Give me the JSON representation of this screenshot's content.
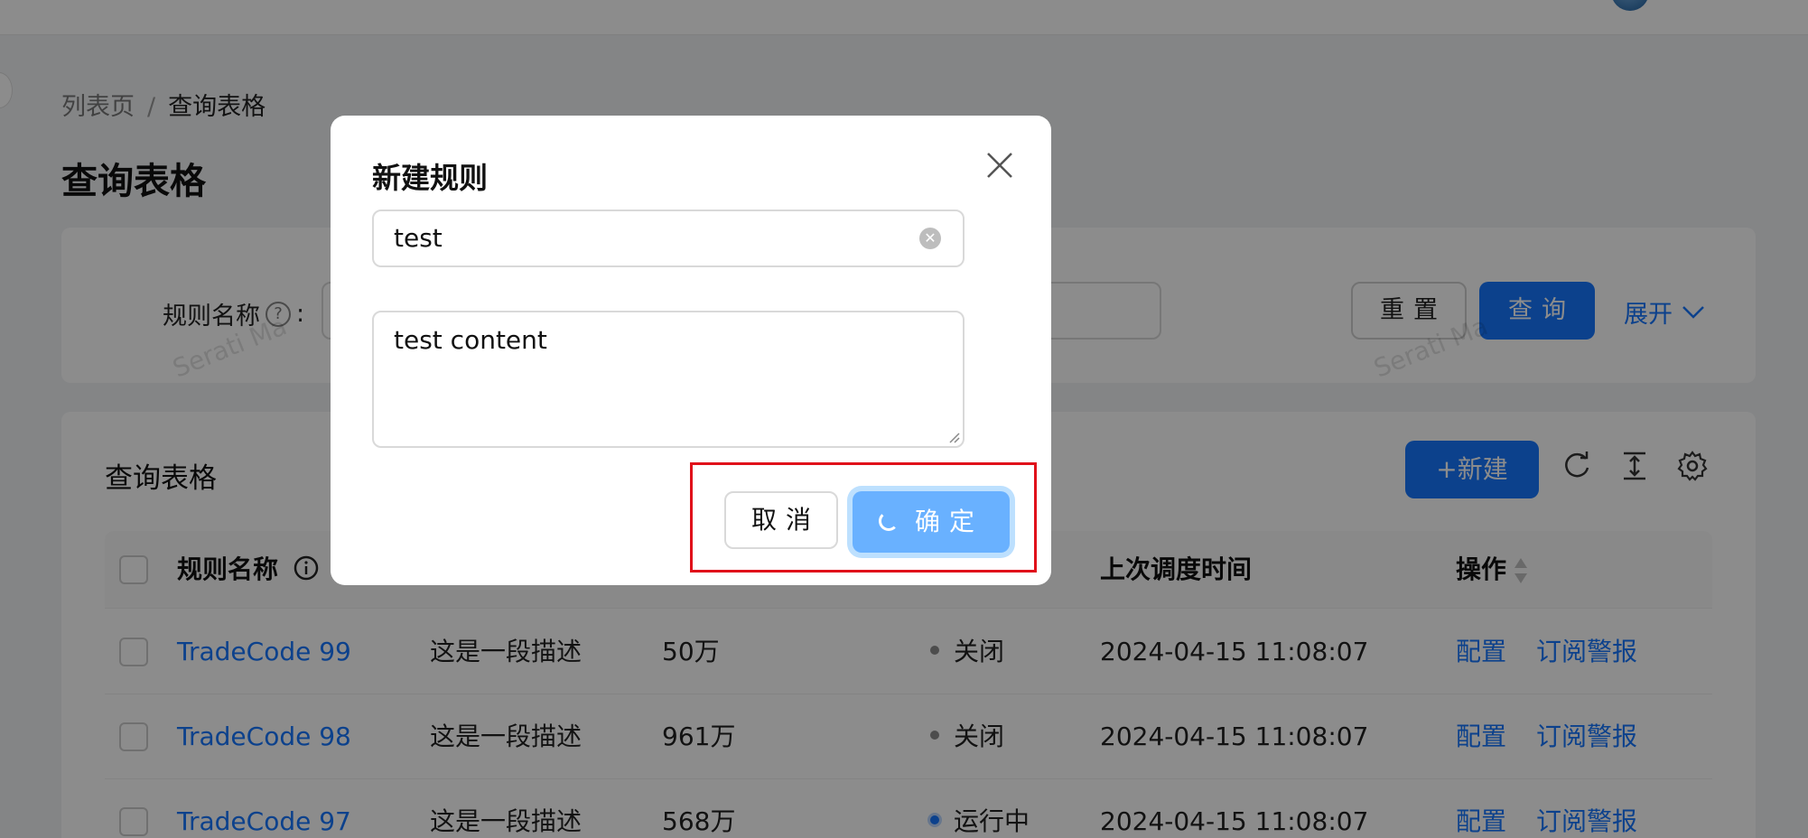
{
  "breadcrumb": {
    "parent": "列表页",
    "separator": "/",
    "current": "查询表格"
  },
  "page_title": "查询表格",
  "search_form": {
    "field_label": "规则名称",
    "help_icon": "question-circle-icon",
    "colon": ":",
    "reset_label": "重置",
    "query_label": "查询",
    "expand_label": "展开"
  },
  "table": {
    "title": "查询表格",
    "new_label": "+新建",
    "columns": [
      "规则名称",
      "上次调度时间",
      "操作"
    ],
    "rows": [
      {
        "name": "TradeCode 99",
        "desc": "这是一段描述",
        "calls": "50万",
        "status": "关闭",
        "status_color": "#8c8c8c",
        "time": "2024-04-15 11:08:07",
        "action1": "配置",
        "action2": "订阅警报"
      },
      {
        "name": "TradeCode 98",
        "desc": "这是一段描述",
        "calls": "961万",
        "status": "关闭",
        "status_color": "#8c8c8c",
        "time": "2024-04-15 11:08:07",
        "action1": "配置",
        "action2": "订阅警报"
      },
      {
        "name": "TradeCode 97",
        "desc": "这是一段描述",
        "calls": "568万",
        "status": "运行中",
        "status_color": "#1677ff",
        "time": "2024-04-15 11:08:07",
        "action1": "配置",
        "action2": "订阅警报"
      }
    ]
  },
  "watermark": "Serati Ma",
  "modal": {
    "title": "新建规则",
    "name_value": "test",
    "content_value": "test content",
    "cancel_label": "取消",
    "ok_label": "确定"
  },
  "colors": {
    "primary": "#1677ff",
    "primary_loading": "#69b1ff",
    "highlight": "#e0101a"
  }
}
